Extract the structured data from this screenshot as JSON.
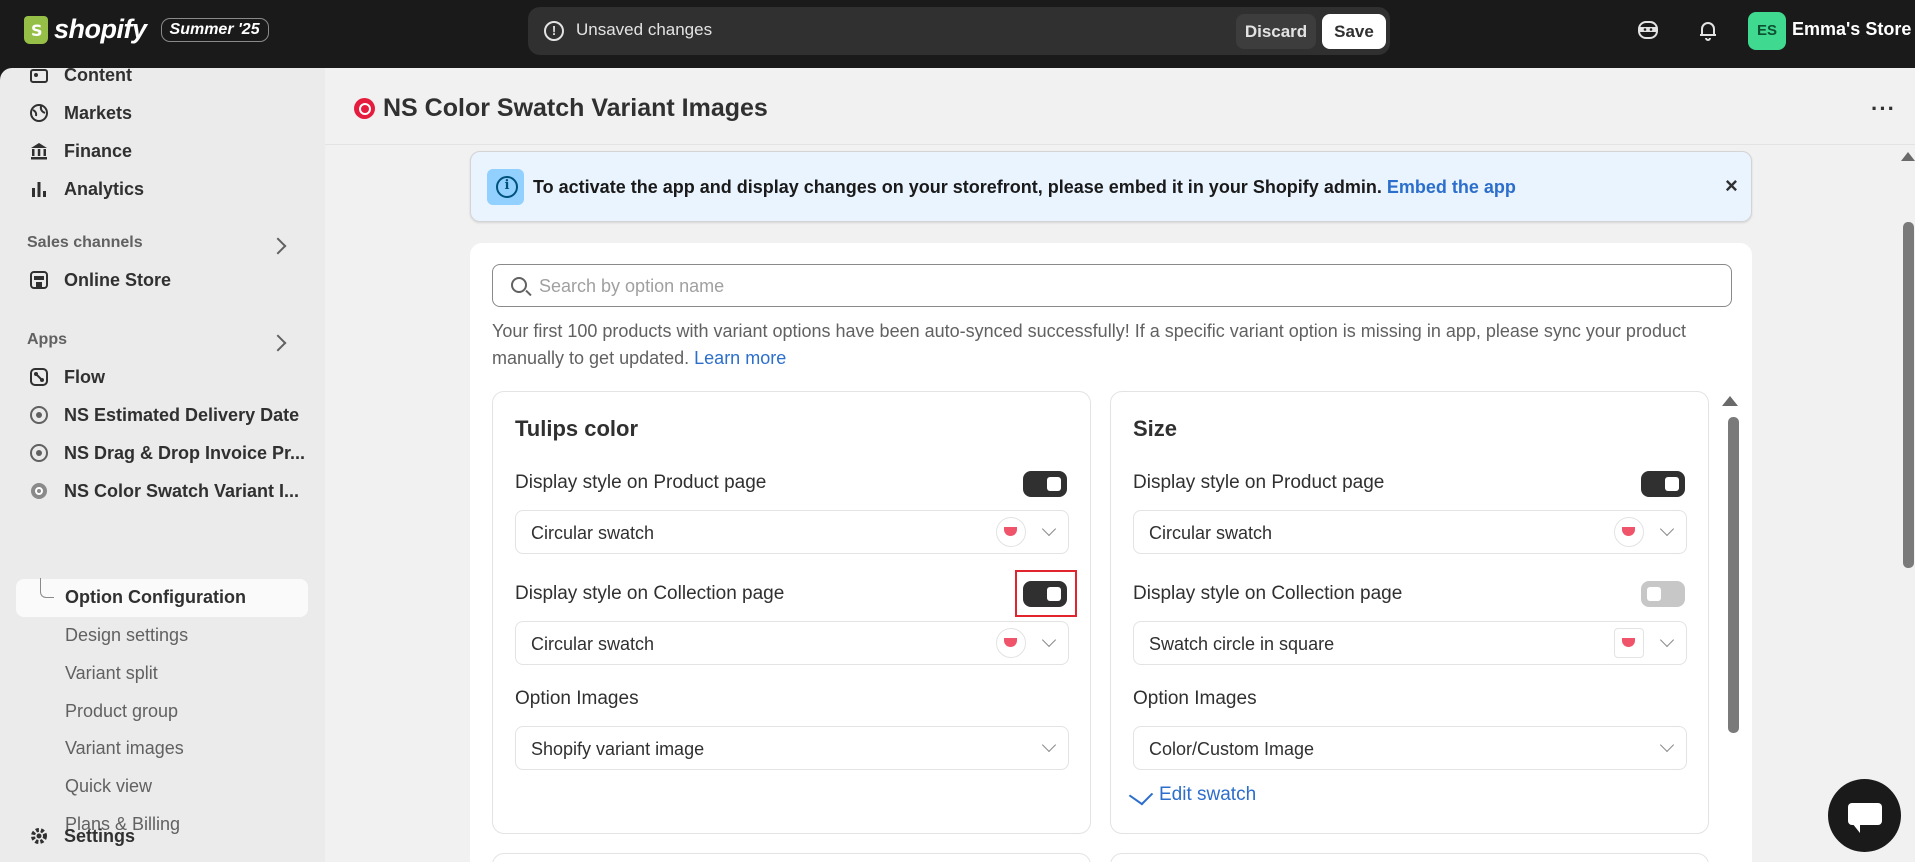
{
  "topbar": {
    "logo_text": "shopify",
    "edition": "Summer '25",
    "unsaved_text": "Unsaved changes",
    "discard_label": "Discard",
    "save_label": "Save",
    "avatar_initials": "ES",
    "store_name": "Emma's Store"
  },
  "sidebar": {
    "items_top": [
      "Content",
      "Markets",
      "Finance",
      "Analytics"
    ],
    "sales_channels_label": "Sales channels",
    "online_store": "Online Store",
    "apps_label": "Apps",
    "apps": [
      "Flow",
      "NS Estimated Delivery Date",
      "NS Drag & Drop Invoice Pr...",
      "NS Color Swatch Variant I..."
    ],
    "sub_items": [
      "Option Configuration",
      "Design settings",
      "Variant split",
      "Product group",
      "Variant images",
      "Quick view",
      "Plans & Billing"
    ],
    "settings": "Settings"
  },
  "app": {
    "title": "NS Color Swatch Variant Images",
    "more": "···"
  },
  "banner": {
    "text": "To activate the app and display changes on your storefront, please embed it in your Shopify admin.",
    "link": "Embed the app",
    "close": "×"
  },
  "search": {
    "placeholder": "Search by option name"
  },
  "sync_note": {
    "text": "Your first 100 products with variant options have been auto-synced successfully! If a specific variant option is missing in app, please sync your product manually to get updated.",
    "link": "Learn more"
  },
  "options": [
    {
      "title": "Tulips color",
      "product_label": "Display style on Product page",
      "product_on": true,
      "product_style": "Circular swatch",
      "collection_label": "Display style on Collection page",
      "collection_on": true,
      "collection_style": "Circular swatch",
      "images_label": "Option Images",
      "images_value": "Shopify variant image"
    },
    {
      "title": "Size",
      "product_label": "Display style on Product page",
      "product_on": true,
      "product_style": "Circular swatch",
      "collection_label": "Display style on Collection page",
      "collection_on": false,
      "collection_style": "Swatch circle in square",
      "images_label": "Option Images",
      "images_value": "Color/Custom Image",
      "edit_link": "Edit swatch"
    }
  ],
  "colors": {
    "accent_link": "#2c6ecb",
    "highlight": "#e0252f",
    "toggle_on": "#303030",
    "avatar": "#40d990"
  }
}
